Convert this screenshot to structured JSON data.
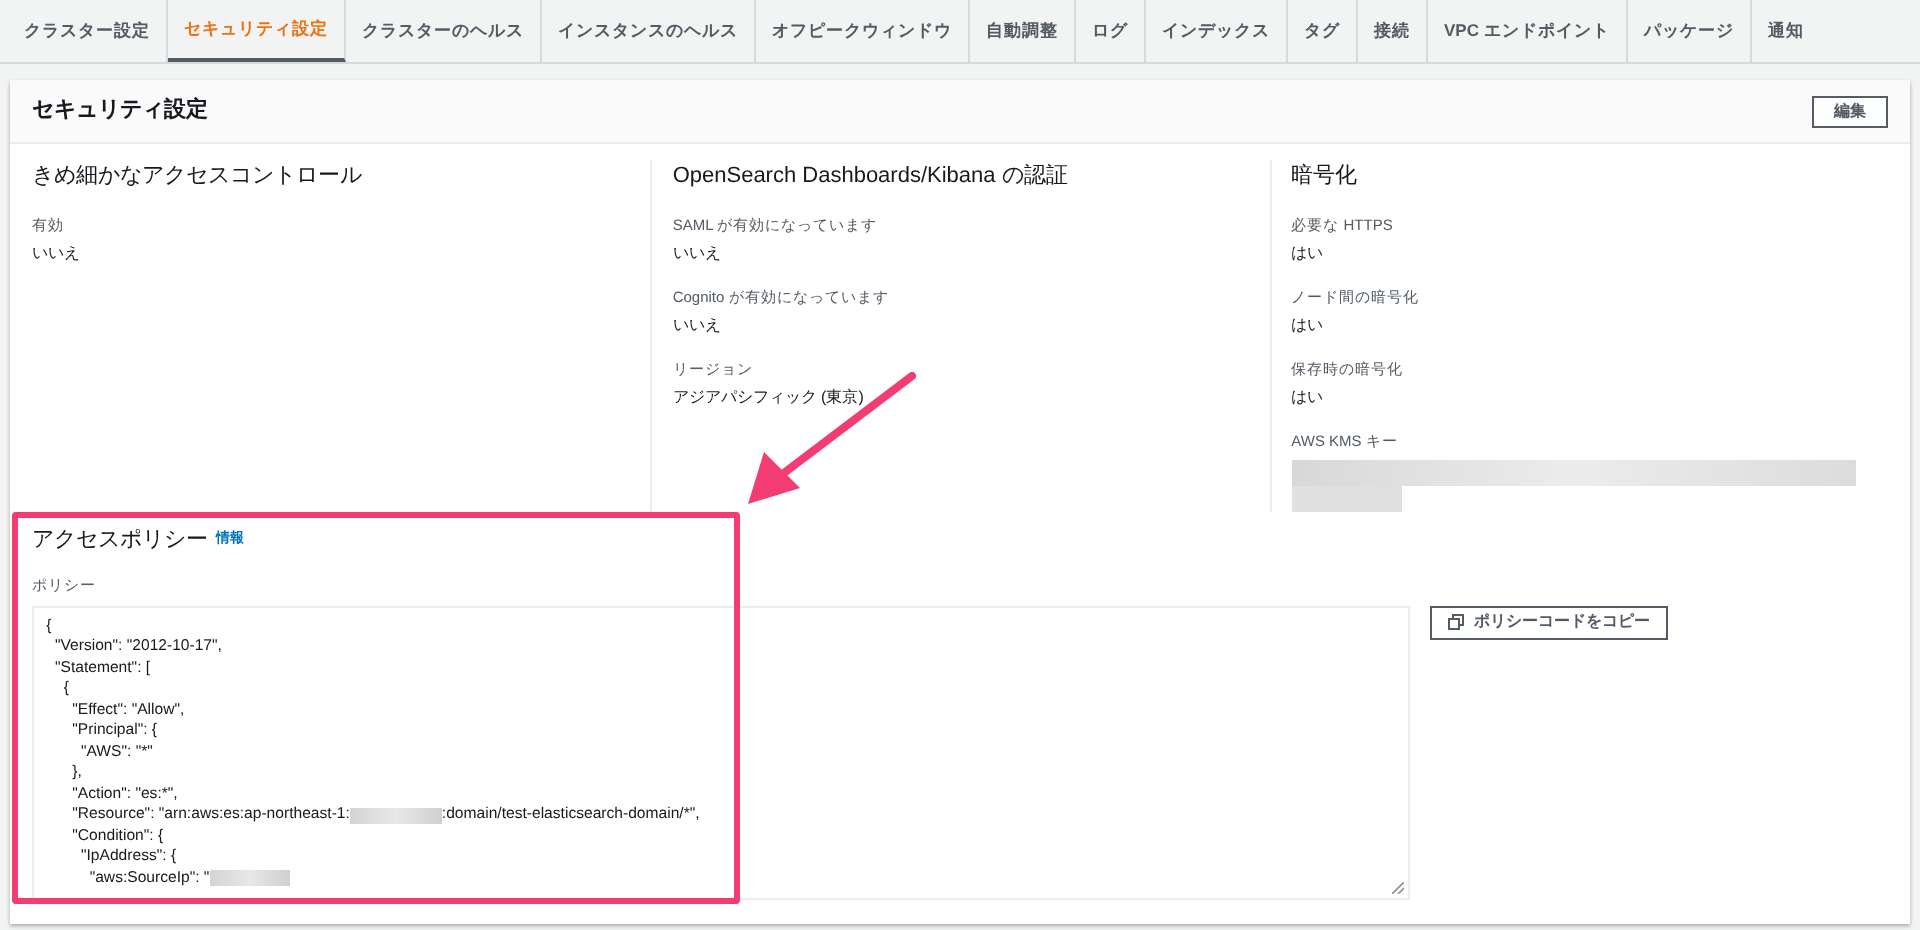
{
  "tabs": [
    {
      "label": "クラスター設定",
      "selected": false
    },
    {
      "label": "セキュリティ設定",
      "selected": true
    },
    {
      "label": "クラスターのヘルス",
      "selected": false
    },
    {
      "label": "インスタンスのヘルス",
      "selected": false
    },
    {
      "label": "オフピークウィンドウ",
      "selected": false
    },
    {
      "label": "自動調整",
      "selected": false
    },
    {
      "label": "ログ",
      "selected": false
    },
    {
      "label": "インデックス",
      "selected": false
    },
    {
      "label": "タグ",
      "selected": false
    },
    {
      "label": "接続",
      "selected": false
    },
    {
      "label": "VPC エンドポイント",
      "selected": false
    },
    {
      "label": "パッケージ",
      "selected": false
    },
    {
      "label": "通知",
      "selected": false
    }
  ],
  "panel": {
    "title": "セキュリティ設定",
    "edit_button": "編集",
    "columns": [
      {
        "title": "きめ細かなアクセスコントロール",
        "fields": [
          {
            "label": "有効",
            "value": "いいえ"
          }
        ]
      },
      {
        "title": "OpenSearch Dashboards/Kibana の認証",
        "fields": [
          {
            "label": "SAML が有効になっています",
            "value": "いいえ"
          },
          {
            "label": "Cognito が有効になっています",
            "value": "いいえ"
          },
          {
            "label": "リージョン",
            "value": "アジアパシフィック (東京)"
          }
        ]
      },
      {
        "title": "暗号化",
        "fields": [
          {
            "label": "必要な HTTPS",
            "value": "はい"
          },
          {
            "label": "ノード間の暗号化",
            "value": "はい"
          },
          {
            "label": "保存時の暗号化",
            "value": "はい"
          },
          {
            "label": "AWS KMS キー",
            "redacted": true
          }
        ]
      }
    ],
    "access_policy": {
      "title": "アクセスポリシー",
      "info_link": "情報",
      "field_label": "ポリシー",
      "copy_button": "ポリシーコードをコピー",
      "lines": [
        {
          "text": " {"
        },
        {
          "text": "   \"Version\": \"2012-10-17\","
        },
        {
          "text": "   \"Statement\": ["
        },
        {
          "text": "     {"
        },
        {
          "text": "       \"Effect\": \"Allow\","
        },
        {
          "text": "       \"Principal\": {"
        },
        {
          "text": "         \"AWS\": \"*\""
        },
        {
          "text": "       },"
        },
        {
          "text": "       \"Action\": \"es:*\","
        },
        {
          "text": "       \"Resource\": \"arn:aws:es:ap-northeast-1:",
          "redacted": true,
          "tail": ":domain/test-elasticsearch-domain/*\","
        },
        {
          "text": "       \"Condition\": {"
        },
        {
          "text": "         \"IpAddress\": {"
        },
        {
          "text": "           \"aws:SourceIp\": \"",
          "redacted": true
        }
      ]
    }
  }
}
